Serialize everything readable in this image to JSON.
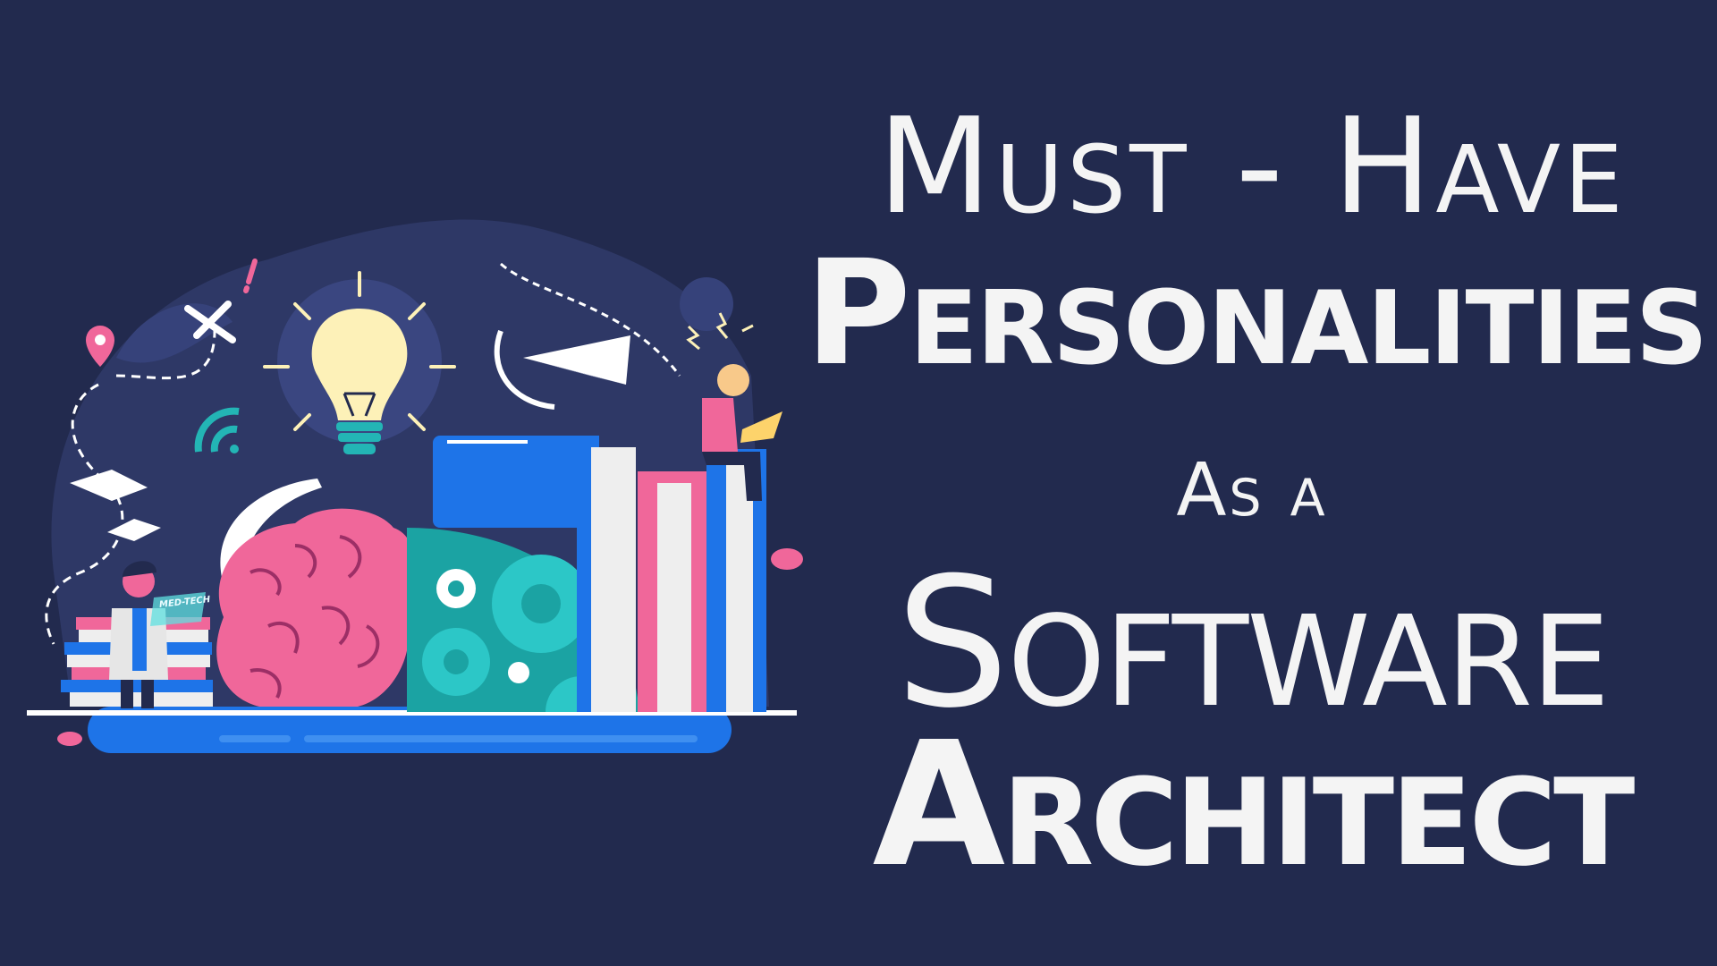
{
  "title": {
    "line1": "Must - Have",
    "line2": "Personalities",
    "line3": "As a",
    "line4": "Software",
    "line5": "Architect"
  },
  "illustration": {
    "tablet_label": "MED-TECH",
    "icons": [
      "lightbulb-icon",
      "brain-icon",
      "gears-icon",
      "books-icon",
      "paper-plane-icon",
      "location-pin-icon",
      "wifi-icon",
      "open-book-icon",
      "laptop-icon"
    ]
  },
  "colors": {
    "background": "#222a4e",
    "blob": "#2e3866",
    "pink": "#f0679a",
    "blue": "#1e74e8",
    "teal": "#23b5b5",
    "bulb": "#fdf1b8",
    "text": "#f4f4f4"
  }
}
